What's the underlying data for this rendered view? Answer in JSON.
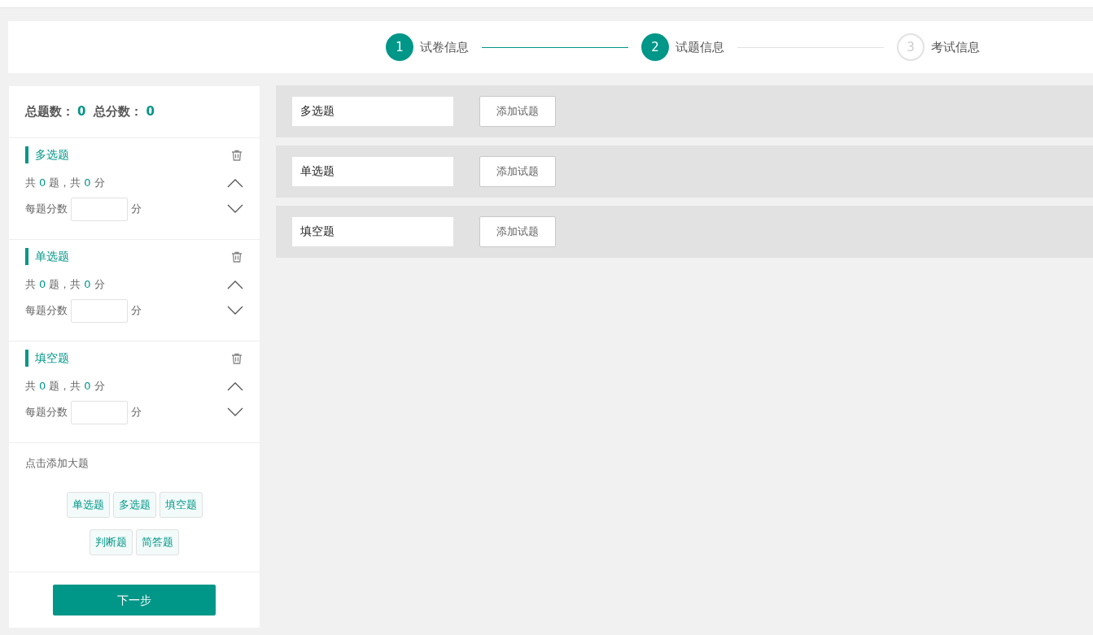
{
  "steps": [
    {
      "number": "1",
      "label": "试卷信息",
      "done": true
    },
    {
      "number": "2",
      "label": "试题信息",
      "done": true
    },
    {
      "number": "3",
      "label": "考试信息",
      "done": false
    }
  ],
  "sidebar": {
    "total_questions_label": "总题数：",
    "total_questions": "0",
    "total_score_label": "总分数：",
    "total_score": "0",
    "sections": [
      {
        "title": "多选题",
        "count_before": "共",
        "count": "0",
        "count_mid": "题，共",
        "score": "0",
        "count_after": "分",
        "per_score_label": "每题分数",
        "per_score_unit": "分"
      },
      {
        "title": "单选题",
        "count_before": "共",
        "count": "0",
        "count_mid": "题，共",
        "score": "0",
        "count_after": "分",
        "per_score_label": "每题分数",
        "per_score_unit": "分"
      },
      {
        "title": "填空题",
        "count_before": "共",
        "count": "0",
        "count_mid": "题，共",
        "score": "0",
        "count_after": "分",
        "per_score_label": "每题分数",
        "per_score_unit": "分"
      }
    ],
    "add_hint": "点击添加大题",
    "add_types": [
      [
        "单选题",
        "多选题",
        "填空题"
      ],
      [
        "判断题",
        "简答题"
      ]
    ],
    "next_button": "下一步"
  },
  "question_groups": [
    {
      "name": "多选题",
      "button": "添加试题"
    },
    {
      "name": "单选题",
      "button": "添加试题"
    },
    {
      "name": "填空题",
      "button": "添加试题"
    }
  ]
}
